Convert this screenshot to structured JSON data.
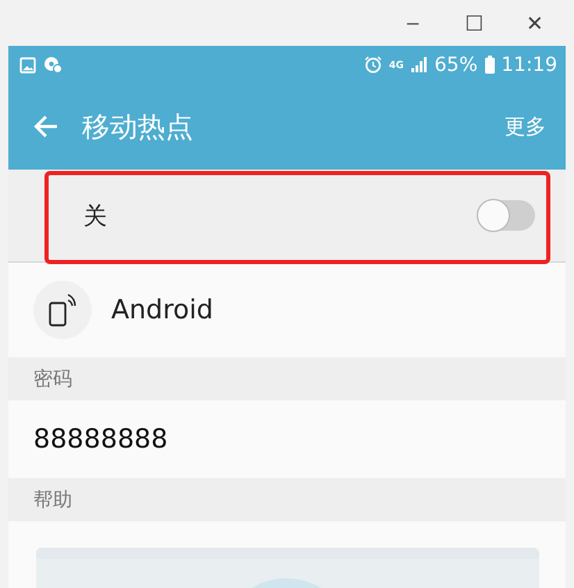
{
  "window": {
    "controls": [
      "–",
      "☐",
      "✕"
    ]
  },
  "status_bar": {
    "network": "4G",
    "battery": "65%",
    "time": "11:19"
  },
  "app_bar": {
    "title": "移动热点",
    "action": "更多"
  },
  "hotspot_switch": {
    "label": "关",
    "on": false,
    "highlighted": true
  },
  "network_name": "Android",
  "sections": [
    {
      "header": "密码",
      "value": "88888888"
    },
    {
      "header": "帮助"
    }
  ]
}
